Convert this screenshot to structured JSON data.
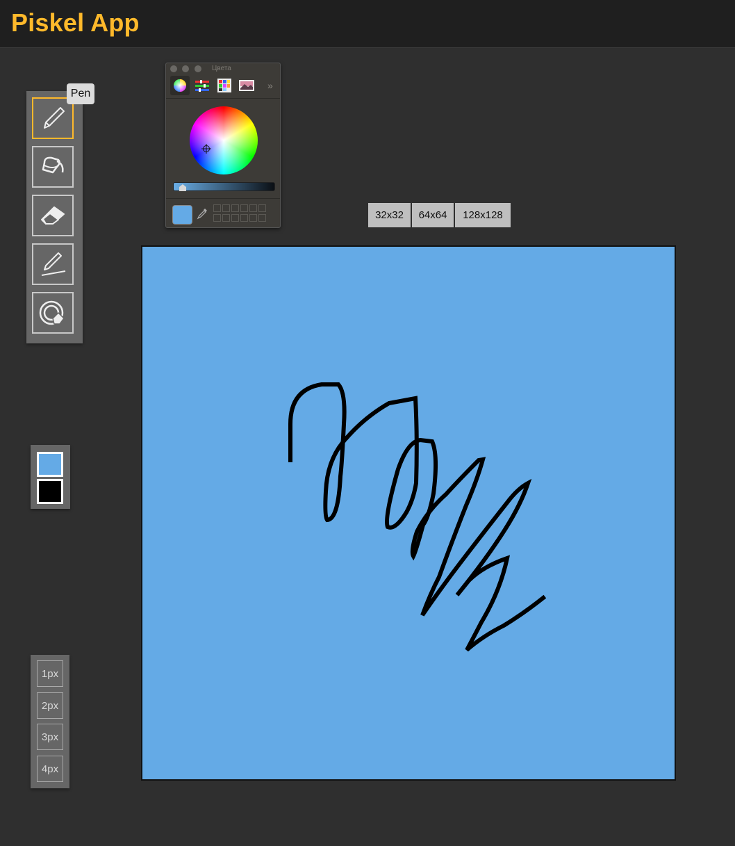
{
  "app": {
    "title": "Piskel App"
  },
  "tooltip": {
    "text": "Pen"
  },
  "tools": [
    {
      "name": "pen",
      "icon": "pen-icon",
      "selected": true
    },
    {
      "name": "bucket",
      "icon": "paint-bucket-icon",
      "selected": false
    },
    {
      "name": "eraser",
      "icon": "eraser-icon",
      "selected": false
    },
    {
      "name": "stroke",
      "icon": "stroke-line-icon",
      "selected": false
    },
    {
      "name": "paint-same-color",
      "icon": "paint-all-icon",
      "selected": false
    }
  ],
  "colors": {
    "primary": "#64aae6",
    "secondary": "#000000",
    "accent": "#ffb92b"
  },
  "pen_sizes": [
    "1px",
    "2px",
    "3px",
    "4px"
  ],
  "color_picker": {
    "title": "Цвета",
    "tabs": [
      "color-wheel-icon",
      "color-sliders-icon",
      "color-palettes-icon",
      "image-palette-icon"
    ]
  },
  "canvas_sizes": [
    "32x32",
    "64x64",
    "128x128"
  ]
}
